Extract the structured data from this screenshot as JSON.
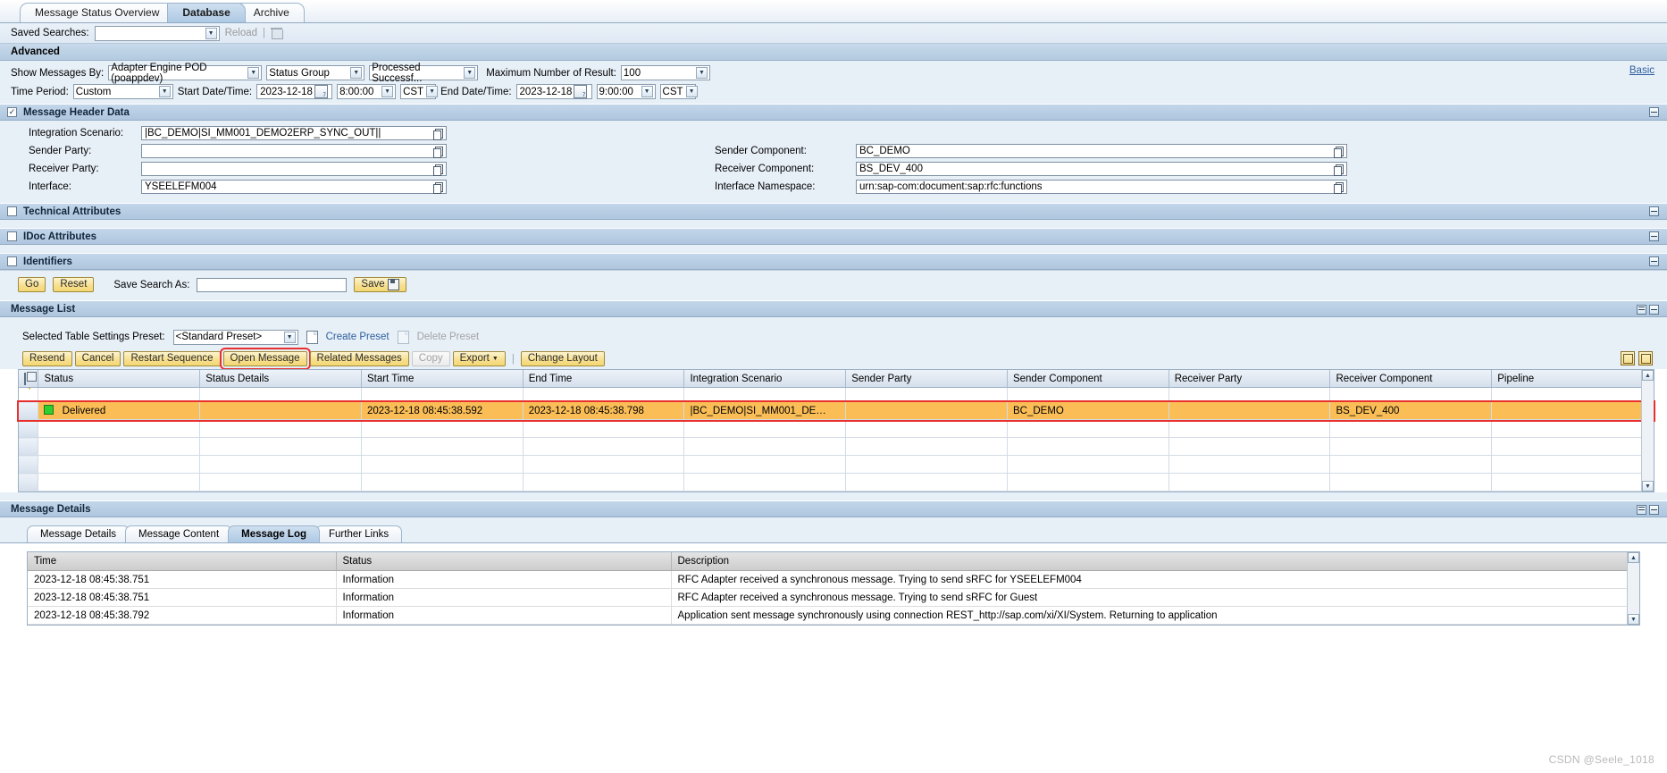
{
  "tabs": [
    {
      "label": "Message Status Overview",
      "active": false
    },
    {
      "label": "Database",
      "active": true
    },
    {
      "label": "Archive",
      "active": false
    }
  ],
  "saved_searches": {
    "label": "Saved Searches:",
    "value": "",
    "reload_label": "Reload",
    "delete_icon": "trash-icon"
  },
  "advanced": {
    "title": "Advanced",
    "basic_link": "Basic",
    "show_messages_by_label": "Show Messages By:",
    "show_messages_by_value": "Adapter Engine POD (poappdev)",
    "status_group_value": "Status Group",
    "status_value": "Processed Successf...",
    "max_result_label": "Maximum Number of Result:",
    "max_result_value": "100",
    "time_period_label": "Time Period:",
    "time_period_value": "Custom",
    "start_label": "Start Date/Time:",
    "start_date": "2023-12-18",
    "start_time": "8:00:00",
    "start_tz": "CST",
    "end_label": "End Date/Time:",
    "end_date": "2023-12-18",
    "end_time": "9:00:00",
    "end_tz": "CST"
  },
  "header_data": {
    "title": "Message Header Data",
    "checked": true,
    "left": [
      {
        "label": "Integration Scenario:",
        "value": "|BC_DEMO|SI_MM001_DEMO2ERP_SYNC_OUT||"
      },
      {
        "label": "Sender Party:",
        "value": ""
      },
      {
        "label": "Receiver Party:",
        "value": ""
      },
      {
        "label": "Interface:",
        "value": "YSEELEFM004"
      }
    ],
    "right": [
      {
        "label": "Sender Component:",
        "value": "BC_DEMO"
      },
      {
        "label": "Receiver Component:",
        "value": "BS_DEV_400"
      },
      {
        "label": "Interface Namespace:",
        "value": "urn:sap-com:document:sap:rfc:functions"
      }
    ]
  },
  "sections": [
    {
      "title": "Technical Attributes",
      "checked": false
    },
    {
      "title": "IDoc Attributes",
      "checked": false
    },
    {
      "title": "Identifiers",
      "checked": false
    }
  ],
  "actions": {
    "go_label": "Go",
    "reset_label": "Reset",
    "save_search_as_label": "Save Search As:",
    "save_search_value": "",
    "save_label": "Save"
  },
  "message_list": {
    "title": "Message List",
    "preset_label": "Selected Table Settings Preset:",
    "preset_value": "<Standard Preset>",
    "create_preset": "Create Preset",
    "delete_preset": "Delete Preset",
    "toolbar": [
      {
        "label": "Resend",
        "enabled": true,
        "highlight": false
      },
      {
        "label": "Cancel",
        "enabled": true,
        "highlight": false
      },
      {
        "label": "Restart Sequence",
        "enabled": true,
        "highlight": false
      },
      {
        "label": "Open Message",
        "enabled": true,
        "highlight": true
      },
      {
        "label": "Related Messages",
        "enabled": true,
        "highlight": false
      },
      {
        "label": "Copy",
        "enabled": false,
        "highlight": false
      },
      {
        "label": "Export",
        "enabled": true,
        "highlight": false
      },
      {
        "label": "Change Layout",
        "enabled": true,
        "highlight": false
      }
    ],
    "columns": [
      "Status",
      "Status Details",
      "Start Time",
      "End Time",
      "Integration Scenario",
      "Sender Party",
      "Sender Component",
      "Receiver Party",
      "Receiver Component",
      "Pipeline"
    ],
    "rows": [
      {
        "status": "Delivered",
        "status_details": "",
        "start_time": "2023-12-18 08:45:38.592",
        "end_time": "2023-12-18 08:45:38.798",
        "integration_scenario": "|BC_DEMO|SI_MM001_DE…",
        "sender_party": "",
        "sender_component": "BC_DEMO",
        "receiver_party": "",
        "receiver_component": "BS_DEV_400",
        "pipeline": "",
        "selected": true
      }
    ],
    "empty_row_count": 4
  },
  "message_details": {
    "title": "Message Details",
    "tabs": [
      {
        "label": "Message Details",
        "active": false
      },
      {
        "label": "Message Content",
        "active": false
      },
      {
        "label": "Message Log",
        "active": true
      },
      {
        "label": "Further Links",
        "active": false
      }
    ],
    "log_columns": [
      "Time",
      "Status",
      "Description"
    ],
    "log_rows": [
      {
        "time": "2023-12-18 08:45:38.751",
        "status": "Information",
        "description": "RFC Adapter received a synchronous message. Trying to send sRFC for YSEELEFM004"
      },
      {
        "time": "2023-12-18 08:45:38.751",
        "status": "Information",
        "description": "RFC Adapter received a synchronous message. Trying to send sRFC for Guest"
      },
      {
        "time": "2023-12-18 08:45:38.792",
        "status": "Information",
        "description": "Application sent message synchronously using connection REST_http://sap.com/xi/XI/System. Returning to application"
      }
    ]
  },
  "watermark": "CSDN @Seele_1018",
  "colors": {
    "accent": "#aec6de",
    "highlight_row": "#fbbe57",
    "selection_outline": "#e8312f",
    "status_ok": "#2fcf2f",
    "button": "#f7de8d"
  }
}
